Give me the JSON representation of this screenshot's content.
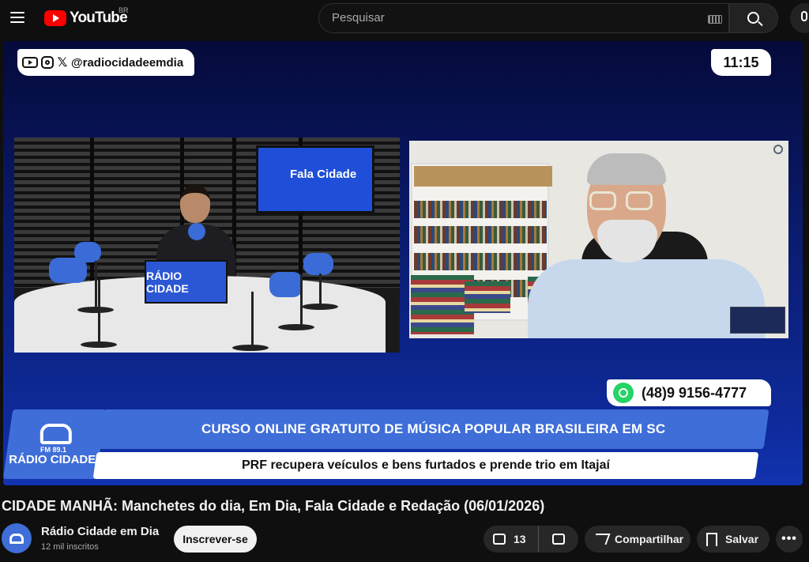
{
  "masthead": {
    "logo_text": "YouTube",
    "region": "BR",
    "search_placeholder": "Pesquisar"
  },
  "video_overlay": {
    "social_handle": "@radiocidadeemdia",
    "clock": "11:15",
    "tv_show": "Fala Cidade",
    "laptop_label": "RÁDIO CIDADE",
    "whatsapp_number": "(48)9 9156-4777",
    "station_fm": "FM 89.1",
    "station_name": "RÁDIO CIDADE",
    "headline_top": "CURSO ONLINE GRATUITO DE MÚSICA POPULAR BRASILEIRA EM SC",
    "headline_bottom": "PRF recupera veículos e bens furtados e prende trio em Itajaí"
  },
  "video": {
    "title": "CIDADE MANHÃ: Manchetes do dia, Em Dia, Fala Cidade e Redação (06/01/2026)"
  },
  "channel": {
    "name": "Rádio Cidade em Dia",
    "subscribers": "12 mil inscritos",
    "subscribe_label": "Inscrever-se"
  },
  "actions": {
    "likes": "13",
    "share_label": "Compartilhar",
    "save_label": "Salvar",
    "more_label": "•••"
  },
  "colors": {
    "brand_red": "#ff0000",
    "station_blue": "#3f6ed8",
    "whatsapp_green": "#25d366"
  }
}
